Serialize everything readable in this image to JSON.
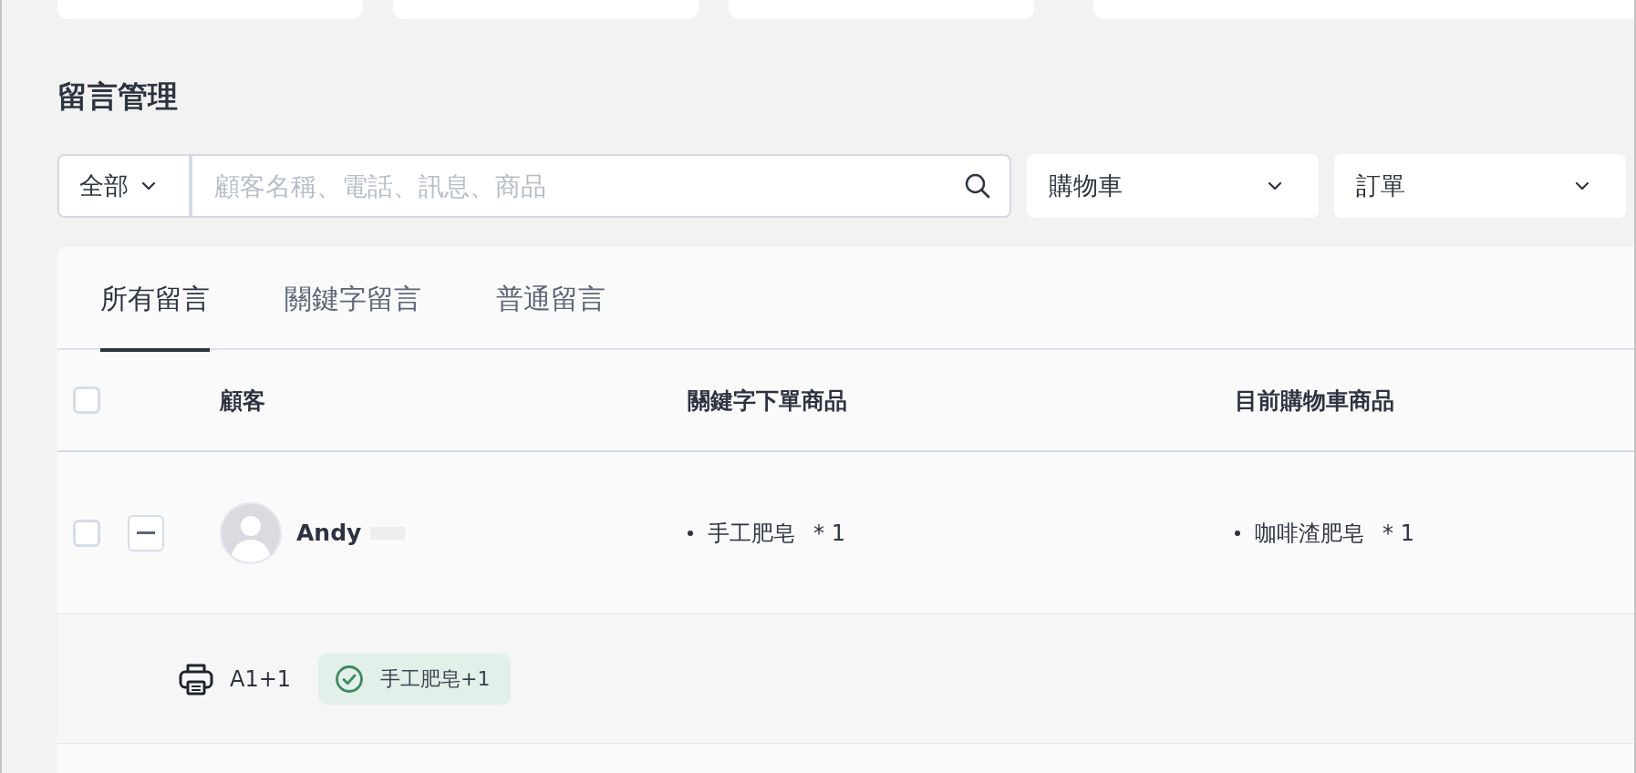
{
  "page_title": "留言管理",
  "filters": {
    "scope": {
      "value": "全部"
    },
    "search": {
      "placeholder": "顧客名稱、電話、訊息、商品"
    },
    "selects": [
      {
        "value": "購物車"
      },
      {
        "value": "訂單"
      }
    ]
  },
  "tabs": [
    {
      "label": "所有留言",
      "selected": true
    },
    {
      "label": "關鍵字留言",
      "selected": false
    },
    {
      "label": "普通留言",
      "selected": false
    }
  ],
  "table": {
    "select_all": {
      "checked": false
    },
    "columns": [
      {
        "label": "顧客"
      },
      {
        "label": "關鍵字下單商品"
      },
      {
        "label": "目前購物車商品"
      }
    ],
    "rows": [
      {
        "checked": false,
        "expanded": true,
        "customer": "Andy",
        "keyword_items": [
          {
            "name": "手工肥皂",
            "qty": "* 1"
          }
        ],
        "cart_items": [
          {
            "name": "咖啡渣肥皂",
            "qty": "* 1"
          }
        ],
        "tags": [
          {
            "kind": "print",
            "text": "A1+1"
          },
          {
            "kind": "done",
            "text": "手工肥皂+1"
          }
        ]
      }
    ]
  }
}
